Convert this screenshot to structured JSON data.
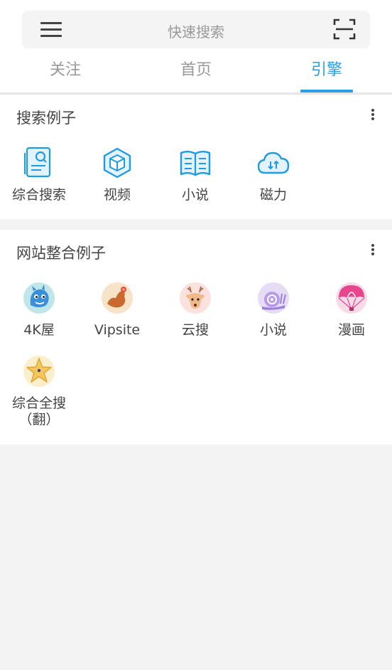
{
  "header": {
    "search_placeholder": "快速搜索"
  },
  "tabs": [
    {
      "label": "关注"
    },
    {
      "label": "首页"
    },
    {
      "label": "引擎"
    }
  ],
  "colors": {
    "accent": "#2a9fe3",
    "background": "#f3f3f4"
  },
  "search_examples": {
    "title": "搜索例子",
    "items": [
      {
        "label": "综合搜索",
        "icon": "document-search-icon"
      },
      {
        "label": "视频",
        "icon": "cube-icon"
      },
      {
        "label": "小说",
        "icon": "open-book-icon"
      },
      {
        "label": "磁力",
        "icon": "cloud-icon"
      }
    ]
  },
  "site_examples": {
    "title": "网站整合例子",
    "items": [
      {
        "label": "4K屋",
        "icon": "blue-creature-avatar-icon"
      },
      {
        "label": "Vipsite",
        "icon": "flexed-arm-avatar-icon"
      },
      {
        "label": "云搜",
        "icon": "deer-avatar-icon"
      },
      {
        "label": "小说",
        "icon": "snail-avatar-icon"
      },
      {
        "label": "漫画",
        "icon": "parachute-avatar-icon"
      },
      {
        "label": "综合全搜\n（翻）",
        "icon": "starfish-avatar-icon"
      }
    ]
  }
}
